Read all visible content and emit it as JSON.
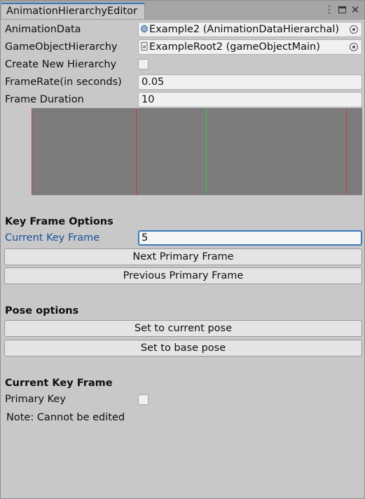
{
  "window": {
    "tab_title": "AnimationHierarchyEditor",
    "actions": [
      "kebab-menu-icon",
      "maximize-icon",
      "close-icon"
    ]
  },
  "fields": {
    "animation_data": {
      "label": "AnimationData",
      "value": "Example2 (AnimationDataHierarchal)"
    },
    "gameobject_hierarchy": {
      "label": "GameObjectHierarchy",
      "value": "ExampleRoot2 (gameObjectMain)"
    },
    "create_new_hierarchy": {
      "label": "Create New Hierarchy",
      "checked": false
    },
    "frame_rate": {
      "label": "FrameRate(in seconds)",
      "value": "0.05"
    },
    "frame_duration": {
      "label": "Frame Duration",
      "value": "10"
    }
  },
  "timeline": {
    "background": "#7c7c7c",
    "marker_colors": {
      "red": "#d23a3a",
      "green": "#3ec43e"
    }
  },
  "key_frame_options": {
    "heading": "Key Frame Options",
    "current_key_frame_label": "Current Key Frame",
    "current_key_frame_value": "5",
    "next_button": "Next Primary Frame",
    "prev_button": "Previous Primary Frame"
  },
  "pose_options": {
    "heading": "Pose options",
    "set_current_button": "Set to current pose",
    "set_base_button": "Set to base pose"
  },
  "current_key_frame": {
    "heading": "Current Key Frame",
    "primary_key_label": "Primary Key",
    "primary_key_checked": false,
    "note": "Note: Cannot be edited"
  },
  "colors": {
    "accent": "#3a79bb",
    "panel": "#c8c8c8"
  }
}
